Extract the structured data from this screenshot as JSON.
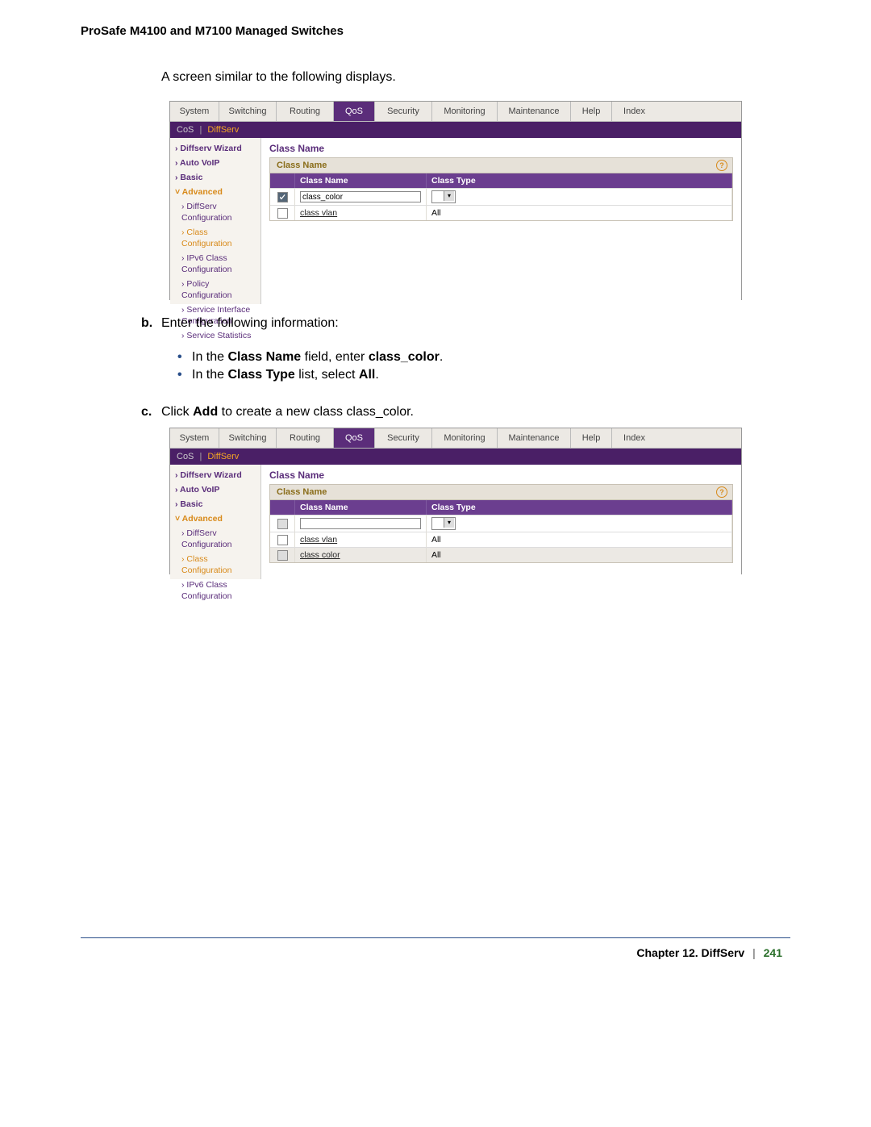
{
  "doc_header": "ProSafe M4100 and M7100 Managed Switches",
  "intro": "A screen similar to the following displays.",
  "tabs": {
    "system": "System",
    "switching": "Switching",
    "routing": "Routing",
    "qos": "QoS",
    "security": "Security",
    "monitoring": "Monitoring",
    "maintenance": "Maintenance",
    "help": "Help",
    "index": "Index"
  },
  "subbar": {
    "cos": "CoS",
    "diffserv": "DiffServ"
  },
  "sidebar": {
    "items": [
      {
        "label": "Diffserv Wizard",
        "bold": true,
        "caret": true
      },
      {
        "label": "Auto VoIP",
        "bold": true,
        "caret": true
      },
      {
        "label": "Basic",
        "bold": true,
        "caret": true
      },
      {
        "label": "Advanced",
        "bold": true,
        "orange": true,
        "down": true
      },
      {
        "label": "DiffServ Configuration",
        "sub": true,
        "caret": true
      },
      {
        "label": "Class Configuration",
        "sub": true,
        "orange": true,
        "caret": true
      },
      {
        "label": "IPv6 Class Configuration",
        "sub": true,
        "caret": true
      },
      {
        "label": "Policy Configuration",
        "sub": true,
        "caret": true
      },
      {
        "label": "Service Interface Configuration",
        "sub": true,
        "caret": true
      },
      {
        "label": "Service Statistics",
        "sub": true,
        "caret": true
      }
    ]
  },
  "panel": {
    "title": "Class Name",
    "subtitle": "Class Name",
    "headers": {
      "name": "Class Name",
      "type": "Class Type"
    }
  },
  "shot1": {
    "input_row": {
      "name_value": "class_color",
      "type_value": ""
    },
    "rows": [
      {
        "name": "class vlan",
        "type": "All"
      }
    ]
  },
  "shot2": {
    "input_row": {
      "name_value": "",
      "type_value": ""
    },
    "rows": [
      {
        "name": "class vlan",
        "type": "All"
      },
      {
        "name": "class color",
        "type": "All"
      }
    ],
    "sidebar_items": [
      {
        "label": "Diffserv Wizard",
        "bold": true,
        "caret": true
      },
      {
        "label": "Auto VoIP",
        "bold": true,
        "caret": true
      },
      {
        "label": "Basic",
        "bold": true,
        "caret": true
      },
      {
        "label": "Advanced",
        "bold": true,
        "orange": true,
        "down": true
      },
      {
        "label": "DiffServ Configuration",
        "sub": true,
        "caret": true
      },
      {
        "label": "Class Configuration",
        "sub": true,
        "orange": true,
        "caret": true
      },
      {
        "label": "IPv6 Class Configuration",
        "sub": true,
        "caret": true
      }
    ]
  },
  "steps": {
    "b_label": "b.",
    "b_text": "Enter the following information:",
    "bullet1_pre": "In the ",
    "bullet1_b1": "Class Name",
    "bullet1_mid": " field, enter ",
    "bullet1_b2": "class_color",
    "bullet1_post": ".",
    "bullet2_pre": "In the ",
    "bullet2_b1": "Class Type",
    "bullet2_mid": " list, select ",
    "bullet2_b2": "All",
    "bullet2_post": ".",
    "c_label": "c.",
    "c_pre": "Click ",
    "c_b": "Add",
    "c_post": " to create a new class class_color."
  },
  "footer": {
    "chapter": "Chapter 12.  DiffServ",
    "page": "241"
  }
}
